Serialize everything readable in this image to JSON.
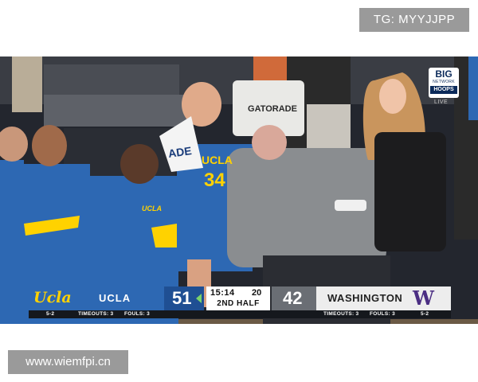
{
  "watermarks": {
    "top": "TG: MYYJJPP",
    "bottom": "www.wiemfpi.cn"
  },
  "network": {
    "big": "BIG",
    "network": "NETWORK",
    "hoops": "HOOPS",
    "live": "LIVE"
  },
  "scene_text": {
    "gatorade": "GATORADE",
    "towel": "ADE",
    "jersey": "UCLA",
    "jersey_number": "34",
    "bench_chest": "UCLA"
  },
  "scoreboard": {
    "home": {
      "logo_text": "Ucla",
      "name": "UCLA",
      "score": "51",
      "record": "5-2",
      "timeouts": "TIMEOUTS: 3",
      "fouls": "FOULS: 3"
    },
    "clock": "15:14",
    "shot_clock": "20",
    "period": "2ND HALF",
    "away": {
      "name": "WASHINGTON",
      "logo": "W",
      "score": "42",
      "record": "5-2",
      "timeouts": "TIMEOUTS: 3",
      "fouls": "FOULS: 3"
    }
  },
  "colors": {
    "ucla_blue": "#2d68b3",
    "ucla_gold": "#ffd200",
    "washington_purple": "#4b2e83",
    "possession_arrow": "#7ad36a"
  }
}
